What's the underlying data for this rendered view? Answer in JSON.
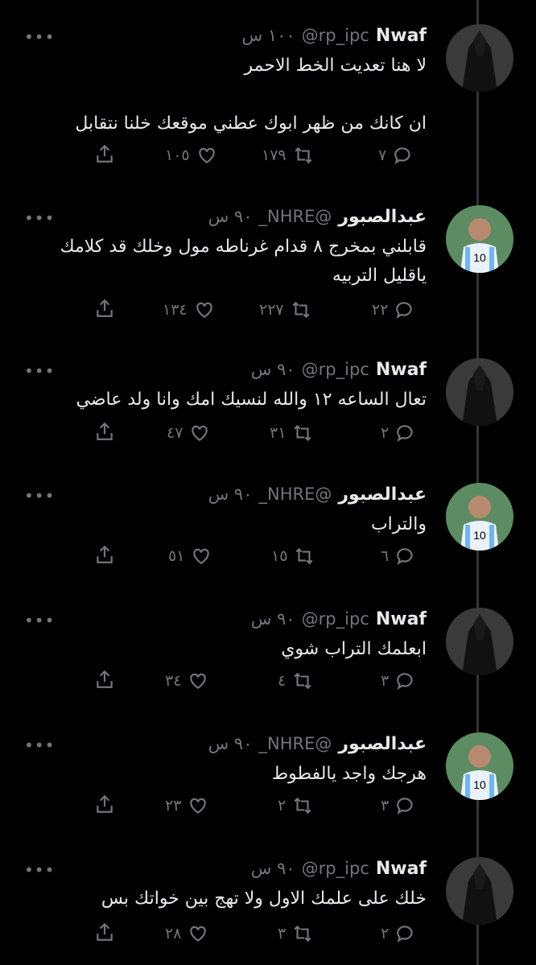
{
  "tweets": [
    {
      "avatar": "masked-figure",
      "name": "Nwaf",
      "handle": "@rp_ipc",
      "time": "١٠٠ س",
      "text": "لا هنا تعديت الخط الاحمر\n\nان كانك من ظهر ابوك عطني موقعك خلنا نتقابل",
      "replies": "٧",
      "retweets": "١٧٩",
      "likes": "١٠٥"
    },
    {
      "avatar": "football-player",
      "name": "عبدالصبور",
      "handle": "_NHRE@",
      "time": "٩٠ س",
      "text": "قابلني بمخرج ٨ قدام غرناطه مول وخلك قد كلامك ياقليل التربيه",
      "replies": "٢٢",
      "retweets": "٢٢٧",
      "likes": "١٣٤"
    },
    {
      "avatar": "masked-figure",
      "name": "Nwaf",
      "handle": "@rp_ipc",
      "time": "٩٠ س",
      "text": "تعال الساعه ١٢ والله لنسيك امك وانا ولد عاضي",
      "replies": "٢",
      "retweets": "٣١",
      "likes": "٤٧"
    },
    {
      "avatar": "football-player",
      "name": "عبدالصبور",
      "handle": "_NHRE@",
      "time": "٩٠ س",
      "text": "والتراب",
      "replies": "٦",
      "retweets": "١٥",
      "likes": "٥١"
    },
    {
      "avatar": "masked-figure",
      "name": "Nwaf",
      "handle": "@rp_ipc",
      "time": "٩٠ س",
      "text": "ابعلمك التراب شوي",
      "replies": "٣",
      "retweets": "٤",
      "likes": "٣٤"
    },
    {
      "avatar": "football-player",
      "name": "عبدالصبور",
      "handle": "_NHRE@",
      "time": "٩٠ س",
      "text": "هرجك واجد يالفطوط",
      "replies": "٣",
      "retweets": "٢",
      "likes": "٢٣"
    },
    {
      "avatar": "masked-figure",
      "name": "Nwaf",
      "handle": "@rp_ipc",
      "time": "٩٠ س",
      "text": "خلك على علمك الاول ولا تهج بين خواتك بس",
      "replies": "٢",
      "retweets": "٣",
      "likes": "٢٨"
    }
  ],
  "colors": {
    "background": "#000000",
    "text": "#e7e9ea",
    "muted": "#71767b",
    "thread_line": "#333639"
  }
}
